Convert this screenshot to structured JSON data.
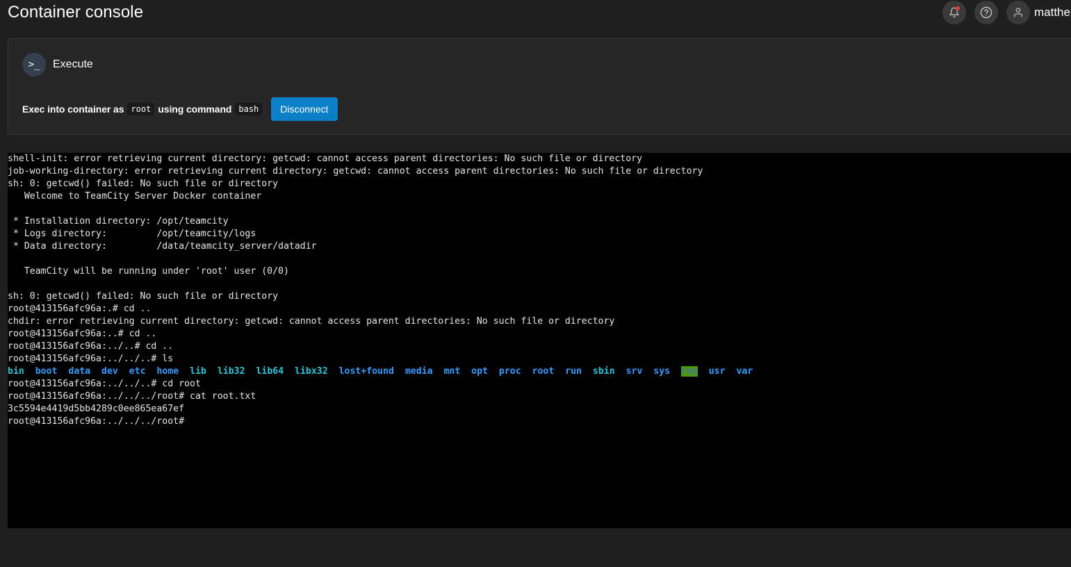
{
  "header": {
    "title": "Container console",
    "username": "matthe"
  },
  "exec": {
    "title": "Execute",
    "icon": "terminal-icon",
    "text_prefix": "Exec into container as",
    "user": "root",
    "text_mid": "using command",
    "command": "bash",
    "disconnect_label": "Disconnect",
    "button_color": "#0b7fc7"
  },
  "terminal": {
    "lines": [
      "shell-init: error retrieving current directory: getcwd: cannot access parent directories: No such file or directory",
      "job-working-directory: error retrieving current directory: getcwd: cannot access parent directories: No such file or directory",
      "sh: 0: getcwd() failed: No such file or directory",
      "   Welcome to TeamCity Server Docker container",
      "",
      " * Installation directory: /opt/teamcity",
      " * Logs directory:         /opt/teamcity/logs",
      " * Data directory:         /data/teamcity_server/datadir",
      "",
      "   TeamCity will be running under 'root' user (0/0)",
      "",
      "sh: 0: getcwd() failed: No such file or directory",
      "root@413156afc96a:.# cd ..",
      "chdir: error retrieving current directory: getcwd: cannot access parent directories: No such file or directory",
      "root@413156afc96a:..# cd ..",
      "root@413156afc96a:../..# cd ..",
      "root@413156afc96a:../../..# ls"
    ],
    "ls_output": [
      {
        "name": "bin",
        "style": "cyan"
      },
      {
        "name": "boot",
        "style": "dir"
      },
      {
        "name": "data",
        "style": "dir"
      },
      {
        "name": "dev",
        "style": "dir"
      },
      {
        "name": "etc",
        "style": "dir"
      },
      {
        "name": "home",
        "style": "dir"
      },
      {
        "name": "lib",
        "style": "cyan"
      },
      {
        "name": "lib32",
        "style": "cyan"
      },
      {
        "name": "lib64",
        "style": "cyan"
      },
      {
        "name": "libx32",
        "style": "cyan"
      },
      {
        "name": "lost+found",
        "style": "dir"
      },
      {
        "name": "media",
        "style": "dir"
      },
      {
        "name": "mnt",
        "style": "dir"
      },
      {
        "name": "opt",
        "style": "dir"
      },
      {
        "name": "proc",
        "style": "dir"
      },
      {
        "name": "root",
        "style": "dir"
      },
      {
        "name": "run",
        "style": "dir"
      },
      {
        "name": "sbin",
        "style": "cyan"
      },
      {
        "name": "srv",
        "style": "dir"
      },
      {
        "name": "sys",
        "style": "dir"
      },
      {
        "name": "tmp",
        "style": "tmp"
      },
      {
        "name": "usr",
        "style": "dir"
      },
      {
        "name": "var",
        "style": "dir"
      }
    ],
    "after_lines": [
      "root@413156afc96a:../../..# cd root",
      "root@413156afc96a:../../../root# cat root.txt",
      "3c5594e4419d5bb4289c0ee865ea67ef",
      "root@413156afc96a:../../../root#"
    ]
  }
}
